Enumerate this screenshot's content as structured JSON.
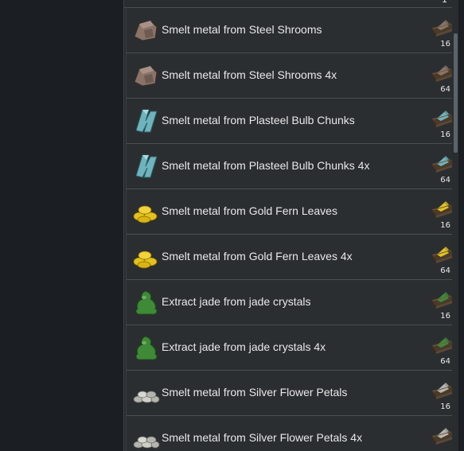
{
  "top_count": "1",
  "recipes": [
    {
      "label": "Smelt metal from Steel Shrooms",
      "count": "16",
      "icon": "steel-shroom-icon",
      "color": "#8a7468"
    },
    {
      "label": "Smelt metal from Steel Shrooms 4x",
      "count": "64",
      "icon": "steel-shroom-icon",
      "color": "#8a7468"
    },
    {
      "label": "Smelt metal from Plasteel Bulb Chunks",
      "count": "16",
      "icon": "plasteel-bulb-icon",
      "color": "#6fb4bd"
    },
    {
      "label": "Smelt metal from Plasteel Bulb Chunks 4x",
      "count": "64",
      "icon": "plasteel-bulb-icon",
      "color": "#6fb4bd"
    },
    {
      "label": "Smelt metal from Gold Fern Leaves",
      "count": "16",
      "icon": "gold-fern-icon",
      "color": "#e4c21e"
    },
    {
      "label": "Smelt metal from Gold Fern Leaves 4x",
      "count": "64",
      "icon": "gold-fern-icon",
      "color": "#e4c21e"
    },
    {
      "label": "Extract jade from jade crystals",
      "count": "16",
      "icon": "jade-crystal-icon",
      "color": "#3e8a36"
    },
    {
      "label": "Extract jade from jade crystals 4x",
      "count": "64",
      "icon": "jade-crystal-icon",
      "color": "#3e8a36"
    },
    {
      "label": "Smelt metal from Silver Flower Petals",
      "count": "16",
      "icon": "silver-petal-icon",
      "color": "#b5b5b0"
    },
    {
      "label": "Smelt metal from Silver Flower Petals 4x",
      "count": "",
      "icon": "silver-petal-icon",
      "color": "#b5b5b0"
    }
  ]
}
